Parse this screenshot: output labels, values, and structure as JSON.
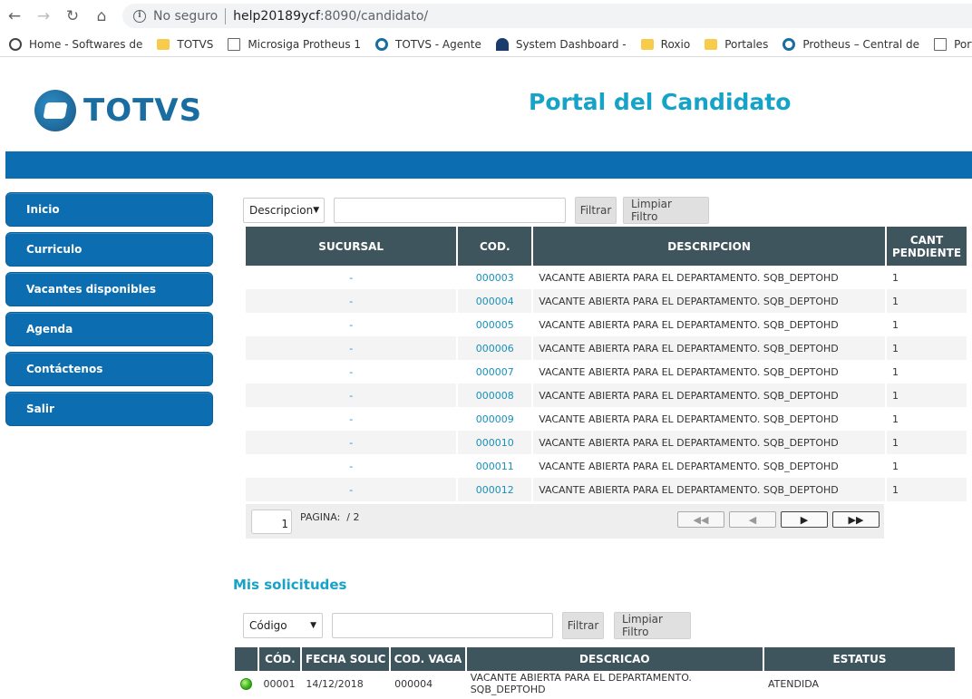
{
  "browser": {
    "insecure_label": "No seguro",
    "url_host": "help20189ycf",
    "url_path": ":8090/candidato/",
    "bookmarks": [
      {
        "label": "Home - Softwares de",
        "icon": "home-icon"
      },
      {
        "label": "TOTVS",
        "icon": "folder-icon"
      },
      {
        "label": "Microsiga Protheus 1",
        "icon": "page-icon"
      },
      {
        "label": "TOTVS - Agente",
        "icon": "globe-icon"
      },
      {
        "label": "System Dashboard -",
        "icon": "jira-icon"
      },
      {
        "label": "Roxio",
        "icon": "folder-icon"
      },
      {
        "label": "Portales",
        "icon": "folder-icon"
      },
      {
        "label": "Protheus – Central de",
        "icon": "globe-icon"
      },
      {
        "label": "Portal de Nor",
        "icon": "page-icon"
      }
    ]
  },
  "header": {
    "logo_text": "TOTVS",
    "title": "Portal del Candidato"
  },
  "menu": {
    "items": [
      "Inicio",
      "Curriculo",
      "Vacantes disponibles",
      "Agenda",
      "Contáctenos",
      "Salir"
    ]
  },
  "vacancies": {
    "filter": {
      "select_value": "Descripcion",
      "filter_button": "Filtrar",
      "clear_button": "Limpiar Filtro"
    },
    "headers": {
      "sucursal": "SUCURSAL",
      "cod": "COD.",
      "descripcion": "DESCRIPCION",
      "cant_line1": "CANT",
      "cant_line2": "PENDIENTE"
    },
    "rows": [
      {
        "sucursal": "-",
        "cod": "000003",
        "descripcion": "VACANTE ABIERTA PARA EL DEPARTAMENTO. SQB_DEPTOHD",
        "cant": "1"
      },
      {
        "sucursal": "-",
        "cod": "000004",
        "descripcion": "VACANTE ABIERTA PARA EL DEPARTAMENTO. SQB_DEPTOHD",
        "cant": "1"
      },
      {
        "sucursal": "-",
        "cod": "000005",
        "descripcion": "VACANTE ABIERTA PARA EL DEPARTAMENTO. SQB_DEPTOHD",
        "cant": "1"
      },
      {
        "sucursal": "-",
        "cod": "000006",
        "descripcion": "VACANTE ABIERTA PARA EL DEPARTAMENTO. SQB_DEPTOHD",
        "cant": "1"
      },
      {
        "sucursal": "-",
        "cod": "000007",
        "descripcion": "VACANTE ABIERTA PARA EL DEPARTAMENTO. SQB_DEPTOHD",
        "cant": "1"
      },
      {
        "sucursal": "-",
        "cod": "000008",
        "descripcion": "VACANTE ABIERTA PARA EL DEPARTAMENTO. SQB_DEPTOHD",
        "cant": "1"
      },
      {
        "sucursal": "-",
        "cod": "000009",
        "descripcion": "VACANTE ABIERTA PARA EL DEPARTAMENTO. SQB_DEPTOHD",
        "cant": "1"
      },
      {
        "sucursal": "-",
        "cod": "000010",
        "descripcion": "VACANTE ABIERTA PARA EL DEPARTAMENTO. SQB_DEPTOHD",
        "cant": "1"
      },
      {
        "sucursal": "-",
        "cod": "000011",
        "descripcion": "VACANTE ABIERTA PARA EL DEPARTAMENTO. SQB_DEPTOHD",
        "cant": "1"
      },
      {
        "sucursal": "-",
        "cod": "000012",
        "descripcion": "VACANTE ABIERTA PARA EL DEPARTAMENTO. SQB_DEPTOHD",
        "cant": "1"
      }
    ],
    "pager": {
      "current_page": "1",
      "label": "PAGINA:",
      "total": "/ 2"
    }
  },
  "solicitudes": {
    "title": "Mis solicitudes",
    "filter": {
      "select_value": "Código",
      "filter_button": "Filtrar",
      "clear_button": "Limpiar Filtro"
    },
    "headers": {
      "cod": "CÓD.",
      "fecha": "FECHA SOLIC",
      "cod_vaga": "COD. VAGA",
      "descricao": "DESCRICAO",
      "estatus": "ESTATUS"
    },
    "rows": [
      {
        "status_color": "#37b01a",
        "cod": "00001",
        "fecha": "14/12/2018",
        "cod_vaga": "000004",
        "descricao": "VACANTE ABIERTA PARA EL DEPARTAMENTO. SQB_DEPTOHD",
        "estatus": "ATENDIDA"
      }
    ]
  }
}
